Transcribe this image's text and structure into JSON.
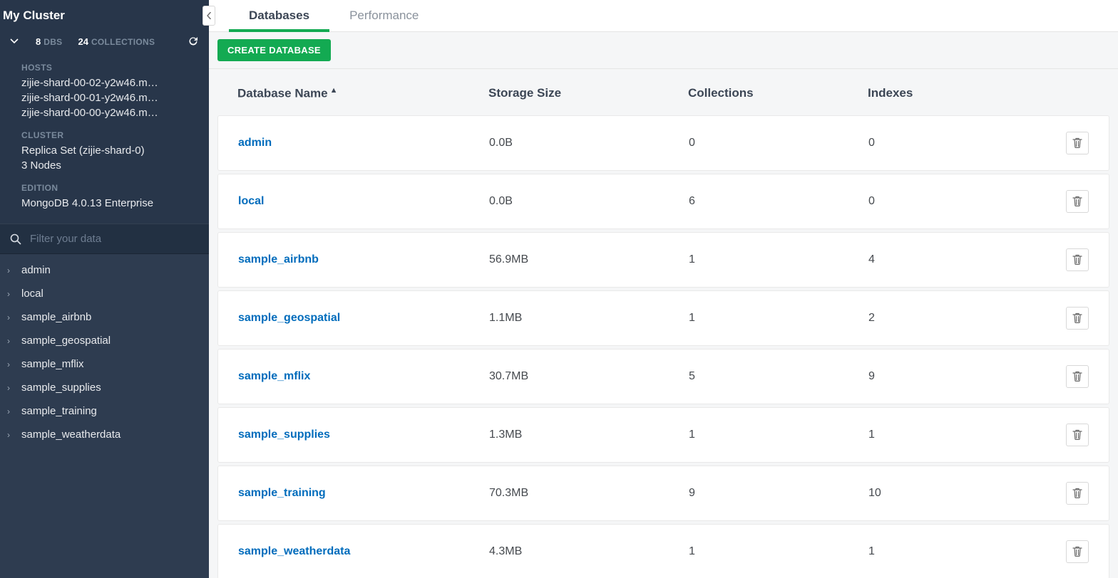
{
  "cluster_title": "My Cluster",
  "stats": {
    "dbs_count": "8",
    "dbs_label": "DBS",
    "collections_count": "24",
    "collections_label": "COLLECTIONS"
  },
  "sections": {
    "hosts_label": "HOSTS",
    "hosts": [
      "zijie-shard-00-02-y2w46.m…",
      "zijie-shard-00-01-y2w46.m…",
      "zijie-shard-00-00-y2w46.m…"
    ],
    "cluster_label": "CLUSTER",
    "cluster_name": "Replica Set (zijie-shard-0)",
    "cluster_nodes": "3 Nodes",
    "edition_label": "EDITION",
    "edition_value": "MongoDB 4.0.13 Enterprise"
  },
  "search": {
    "placeholder": "Filter your data"
  },
  "sidebar_dbs": [
    "admin",
    "local",
    "sample_airbnb",
    "sample_geospatial",
    "sample_mflix",
    "sample_supplies",
    "sample_training",
    "sample_weatherdata"
  ],
  "tabs": {
    "databases": "Databases",
    "performance": "Performance"
  },
  "create_button": "CREATE DATABASE",
  "columns": {
    "name": "Database Name",
    "storage": "Storage Size",
    "collections": "Collections",
    "indexes": "Indexes"
  },
  "rows": [
    {
      "name": "admin",
      "storage": "0.0B",
      "collections": "0",
      "indexes": "0"
    },
    {
      "name": "local",
      "storage": "0.0B",
      "collections": "6",
      "indexes": "0"
    },
    {
      "name": "sample_airbnb",
      "storage": "56.9MB",
      "collections": "1",
      "indexes": "4"
    },
    {
      "name": "sample_geospatial",
      "storage": "1.1MB",
      "collections": "1",
      "indexes": "2"
    },
    {
      "name": "sample_mflix",
      "storage": "30.7MB",
      "collections": "5",
      "indexes": "9"
    },
    {
      "name": "sample_supplies",
      "storage": "1.3MB",
      "collections": "1",
      "indexes": "1"
    },
    {
      "name": "sample_training",
      "storage": "70.3MB",
      "collections": "9",
      "indexes": "10"
    },
    {
      "name": "sample_weatherdata",
      "storage": "4.3MB",
      "collections": "1",
      "indexes": "1"
    }
  ]
}
